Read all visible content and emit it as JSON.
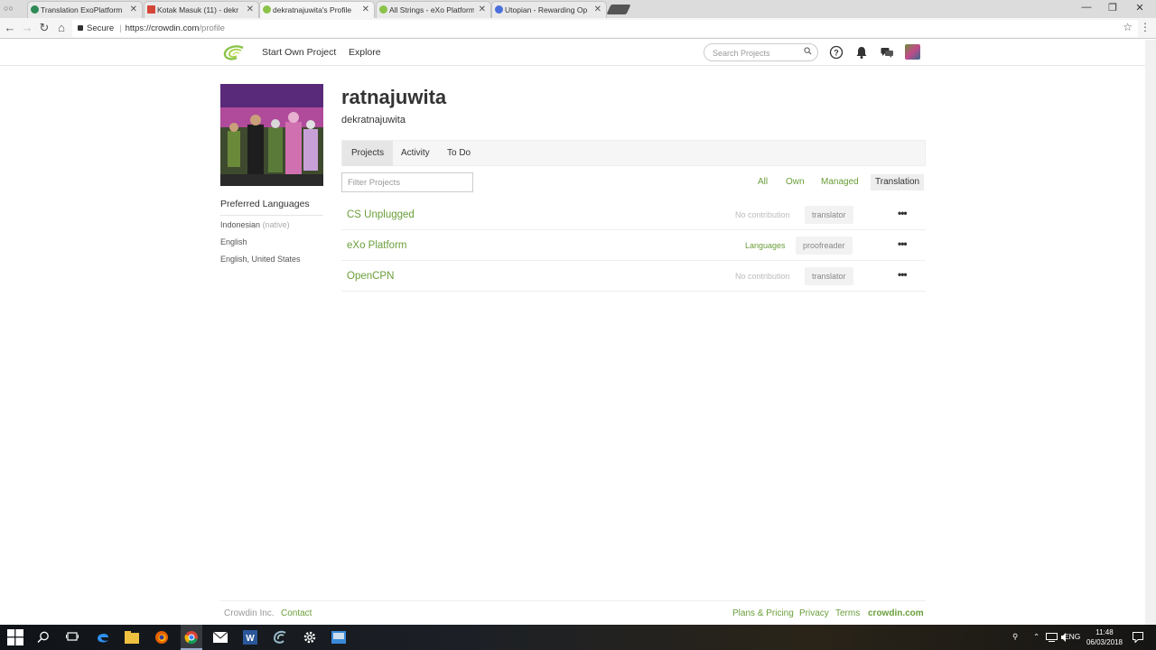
{
  "browser": {
    "tabs": [
      {
        "title": "Translation ExoPlatform",
        "favicon_color": "#2e8b57",
        "active": false
      },
      {
        "title": "Kotak Masuk (11) - dekr",
        "favicon_color": "#d44638",
        "active": false
      },
      {
        "title": "dekratnajuwita's Profile",
        "favicon_color": "#8bc34a",
        "active": true
      },
      {
        "title": "All Strings - eXo Platform",
        "favicon_color": "#8bc34a",
        "active": false
      },
      {
        "title": "Utopian - Rewarding Op",
        "favicon_color": "#4a6fdc",
        "active": false
      }
    ],
    "secure_label": "Secure",
    "url_host": "https://crowdin.com",
    "url_path": "/profile"
  },
  "header": {
    "nav": [
      "Start Own Project",
      "Explore"
    ],
    "search_placeholder": "Search Projects"
  },
  "profile": {
    "display_name": "ratnajuwita",
    "login": "dekratnajuwita",
    "preferred_languages_title": "Preferred Languages",
    "languages": [
      {
        "name": "Indonesian",
        "note": "(native)"
      },
      {
        "name": "English",
        "note": ""
      },
      {
        "name": "English, United States",
        "note": ""
      }
    ]
  },
  "tabs": [
    "Projects",
    "Activity",
    "To Do"
  ],
  "filter_placeholder": "Filter Projects",
  "filters": [
    "All",
    "Own",
    "Managed",
    "Translation"
  ],
  "projects": [
    {
      "name": "CS Unplugged",
      "contribution": "No contribution",
      "role": "translator"
    },
    {
      "name": "eXo Platform",
      "contribution": "Languages",
      "role": "proofreader"
    },
    {
      "name": "OpenCPN",
      "contribution": "No contribution",
      "role": "translator"
    }
  ],
  "footer": {
    "company": "Crowdin Inc.",
    "contact": "Contact",
    "links": [
      "Plans & Pricing",
      "Privacy",
      "Terms"
    ],
    "brand": "crowdin.com"
  },
  "taskbar": {
    "language": "ENG",
    "time": "11:48",
    "date": "06/03/2018"
  },
  "colors": {
    "accent": "#6a9e3a"
  }
}
